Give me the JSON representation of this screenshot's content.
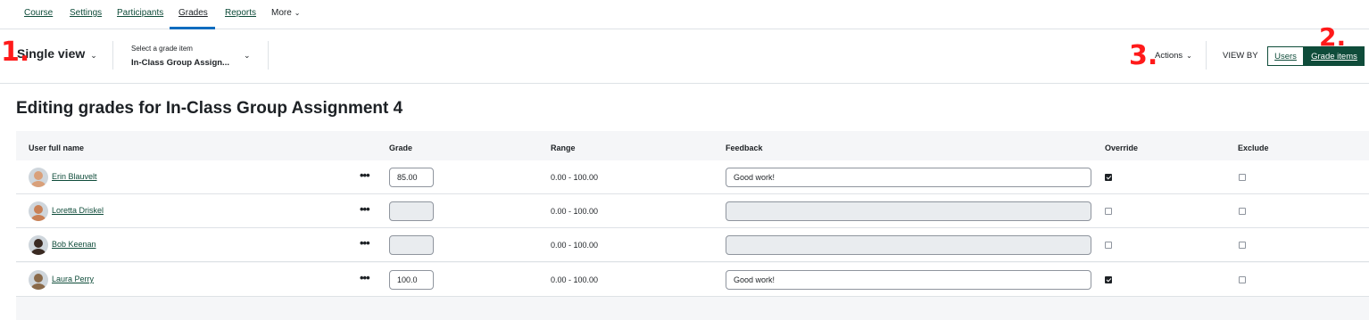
{
  "nav": {
    "tabs": [
      {
        "label": "Course"
      },
      {
        "label": "Settings"
      },
      {
        "label": "Participants"
      },
      {
        "label": "Grades"
      },
      {
        "label": "Reports"
      },
      {
        "label": "More"
      }
    ],
    "active_tab": "Grades"
  },
  "toolbar": {
    "report_select": "Single view",
    "grade_item_label": "Select a grade item",
    "grade_item_value": "In-Class Group Assign...",
    "actions_label": "Actions",
    "view_by_label": "VIEW BY",
    "view_users": "Users",
    "view_grade_items": "Grade items"
  },
  "annotations": {
    "one": "1.",
    "two": "2.",
    "three": "3."
  },
  "page_title": "Editing grades for In-Class Group Assignment 4",
  "table": {
    "headers": {
      "user": "User full name",
      "grade": "Grade",
      "range": "Range",
      "feedback": "Feedback",
      "override": "Override",
      "exclude": "Exclude"
    },
    "rows": [
      {
        "name": "Erin Blauvelt",
        "grade": "85.00",
        "range": "0.00 - 100.00",
        "feedback": "Good work!",
        "override": true,
        "exclude": false,
        "editable": true,
        "avatar_color": "#d9a07a"
      },
      {
        "name": "Loretta Driskel",
        "grade": "",
        "range": "0.00 - 100.00",
        "feedback": "",
        "override": false,
        "exclude": false,
        "editable": false,
        "avatar_color": "#c98055"
      },
      {
        "name": "Bob Keenan",
        "grade": "",
        "range": "0.00 - 100.00",
        "feedback": "",
        "override": false,
        "exclude": false,
        "editable": false,
        "avatar_color": "#3a2a22"
      },
      {
        "name": "Laura Perry",
        "grade": "100.0",
        "range": "0.00 - 100.00",
        "feedback": "Good work!",
        "override": true,
        "exclude": false,
        "editable": true,
        "avatar_color": "#8a6a4a"
      }
    ],
    "actions_glyph": "•••"
  },
  "colors": {
    "brand": "#0f4c3a",
    "annotation": "#ff1a1a",
    "table_bg": "#f5f6f8"
  }
}
